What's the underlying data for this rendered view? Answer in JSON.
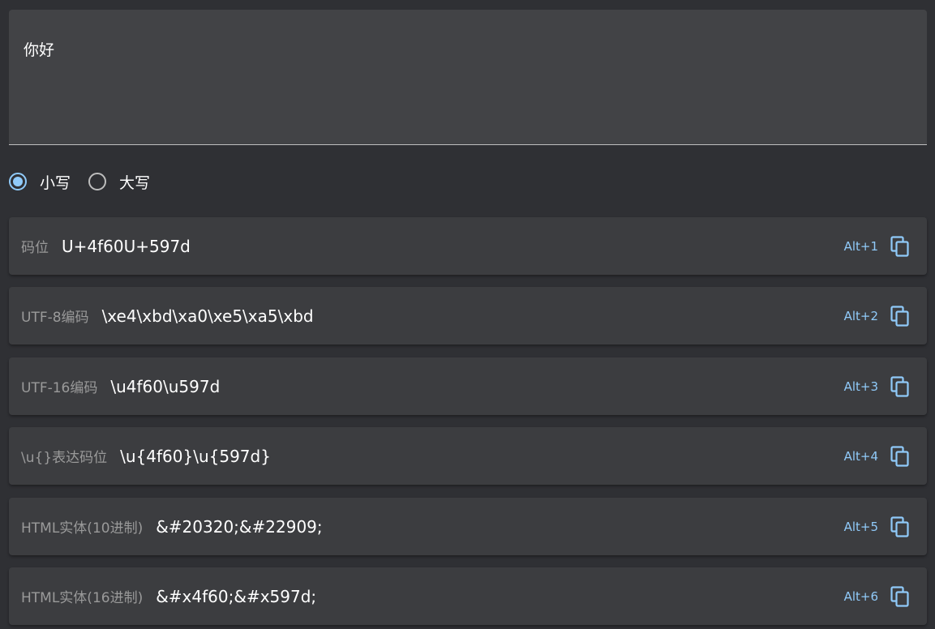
{
  "input": {
    "value": "你好"
  },
  "case_options": [
    {
      "label": "小写",
      "checked": true
    },
    {
      "label": "大写",
      "checked": false
    }
  ],
  "results": [
    {
      "label": "码位",
      "value": "U+4f60U+597d",
      "shortcut": "Alt+1"
    },
    {
      "label": "UTF-8编码",
      "value": "\\xe4\\xbd\\xa0\\xe5\\xa5\\xbd",
      "shortcut": "Alt+2"
    },
    {
      "label": "UTF-16编码",
      "value": "\\u4f60\\u597d",
      "shortcut": "Alt+3"
    },
    {
      "label": "\\u{}表达码位",
      "value": "\\u{4f60}\\u{597d}",
      "shortcut": "Alt+4"
    },
    {
      "label": "HTML实体(10进制)",
      "value": "&#20320;&#22909;",
      "shortcut": "Alt+5"
    },
    {
      "label": "HTML实体(16进制)",
      "value": "&#x4f60;&#x597d;",
      "shortcut": "Alt+6"
    }
  ],
  "colors": {
    "accent": "#90caf9",
    "background": "#2f3034",
    "card": "#3c3d40",
    "input": "#424346"
  },
  "icons": {
    "copy": "copy-icon"
  }
}
